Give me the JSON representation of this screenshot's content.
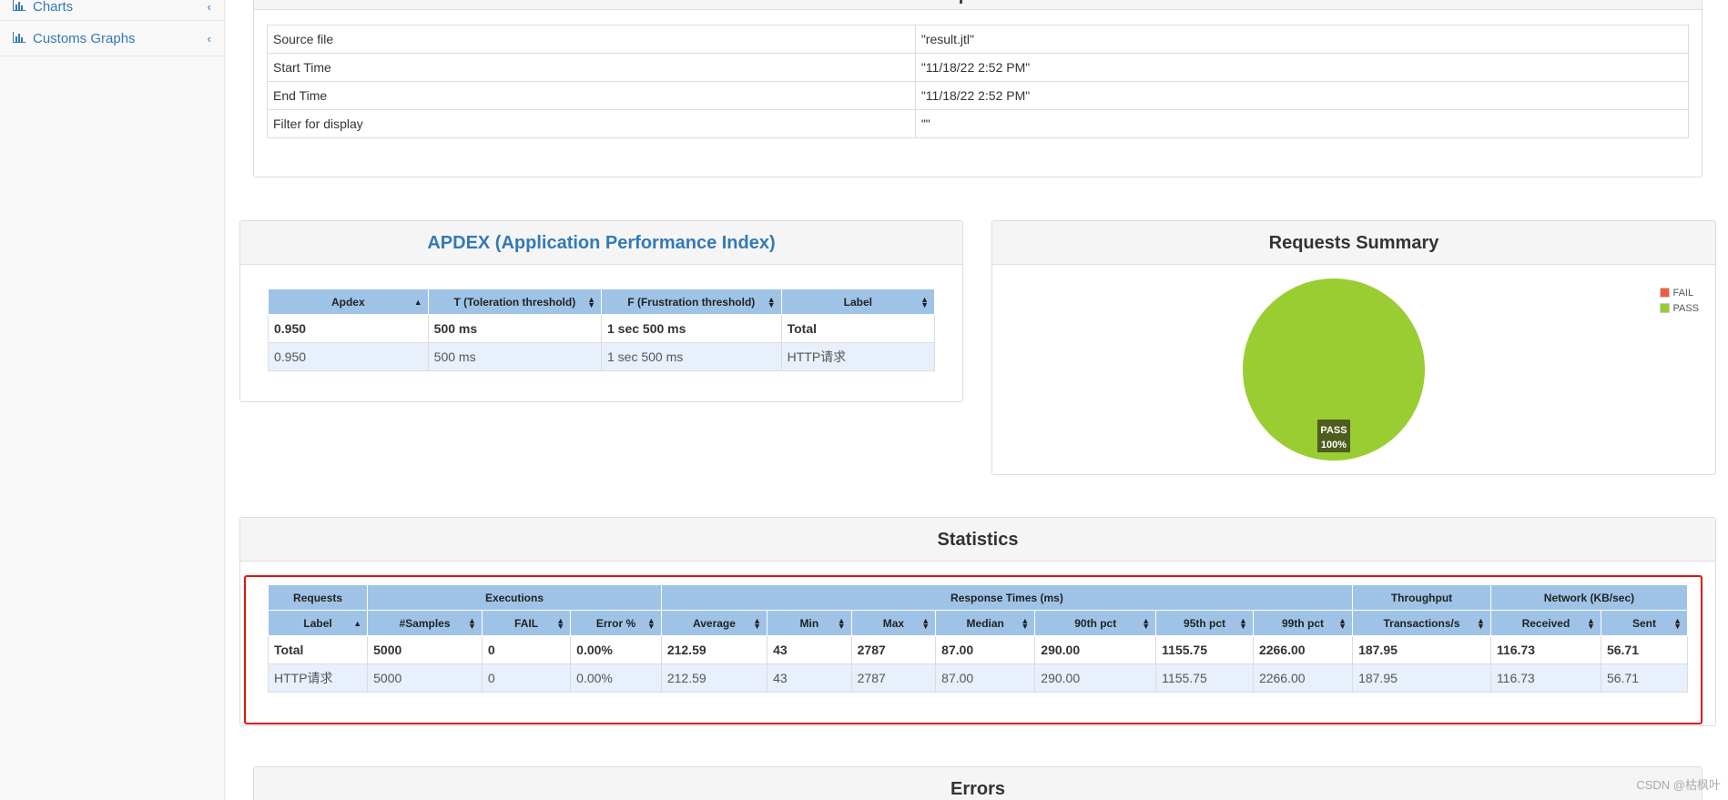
{
  "sidebar": {
    "items": [
      {
        "label": "Charts",
        "icon": "bar-chart-icon"
      },
      {
        "label": "Customs Graphs",
        "icon": "bar-chart-icon"
      }
    ]
  },
  "test_info": {
    "title": "Test and Report information",
    "rows": [
      {
        "key": "Source file",
        "value": "\"result.jtl\""
      },
      {
        "key": "Start Time",
        "value": "\"11/18/22 2:52 PM\""
      },
      {
        "key": "End Time",
        "value": "\"11/18/22 2:52 PM\""
      },
      {
        "key": "Filter for display",
        "value": "\"\""
      }
    ]
  },
  "apdex": {
    "title": "APDEX (Application Performance Index)",
    "headers": [
      "Apdex",
      "T (Toleration threshold)",
      "F (Frustration threshold)",
      "Label"
    ],
    "rows": [
      [
        "0.950",
        "500 ms",
        "1 sec 500 ms",
        "Total"
      ],
      [
        "0.950",
        "500 ms",
        "1 sec 500 ms",
        "HTTP请求"
      ]
    ]
  },
  "summary": {
    "title": "Requests Summary",
    "legend": [
      {
        "label": "FAIL",
        "color": "#f15b40"
      },
      {
        "label": "PASS",
        "color": "#9acd32"
      }
    ],
    "slice_label": "PASS",
    "slice_pct": "100%"
  },
  "chart_data": {
    "type": "pie",
    "title": "Requests Summary",
    "categories": [
      "FAIL",
      "PASS"
    ],
    "values": [
      0,
      100
    ],
    "colors": [
      "#f15b40",
      "#9acd32"
    ],
    "legend": "top-right"
  },
  "statistics": {
    "title": "Statistics",
    "groups": [
      {
        "label": "Requests",
        "span": 1
      },
      {
        "label": "Executions",
        "span": 3
      },
      {
        "label": "Response Times (ms)",
        "span": 7
      },
      {
        "label": "Throughput",
        "span": 1
      },
      {
        "label": "Network (KB/sec)",
        "span": 2
      }
    ],
    "headers": [
      "Label",
      "#Samples",
      "FAIL",
      "Error %",
      "Average",
      "Min",
      "Max",
      "Median",
      "90th pct",
      "95th pct",
      "99th pct",
      "Transactions/s",
      "Received",
      "Sent"
    ],
    "rows": [
      [
        "Total",
        "5000",
        "0",
        "0.00%",
        "212.59",
        "43",
        "2787",
        "87.00",
        "290.00",
        "1155.75",
        "2266.00",
        "187.95",
        "116.73",
        "56.71"
      ],
      [
        "HTTP请求",
        "5000",
        "0",
        "0.00%",
        "212.59",
        "43",
        "2787",
        "87.00",
        "290.00",
        "1155.75",
        "2266.00",
        "187.95",
        "116.73",
        "56.71"
      ]
    ]
  },
  "errors": {
    "title": "Errors"
  },
  "watermark": "CSDN @枯枫叶"
}
